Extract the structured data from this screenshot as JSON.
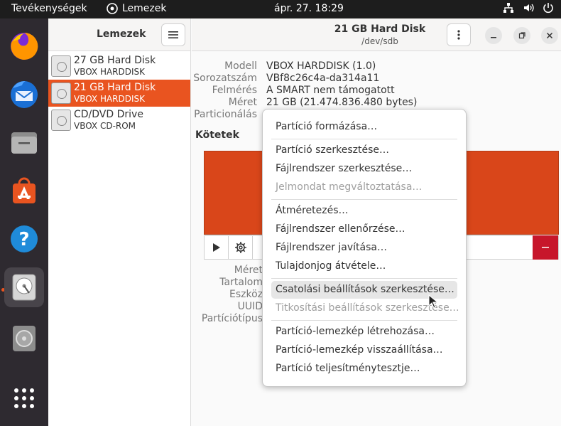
{
  "topbar": {
    "activities": "Tevékenységek",
    "app_name": "Lemezek",
    "clock": "ápr. 27.  18:29"
  },
  "dock": {
    "items": [
      {
        "name": "firefox-icon"
      },
      {
        "name": "thunderbird-icon"
      },
      {
        "name": "files-icon"
      },
      {
        "name": "app-center-icon"
      },
      {
        "name": "help-icon"
      },
      {
        "name": "disks-icon",
        "active": true
      },
      {
        "name": "disc-icon"
      },
      {
        "name": "app-grid-icon"
      }
    ]
  },
  "left": {
    "title": "Lemezek",
    "drives": [
      {
        "name": "27 GB Hard Disk",
        "model": "VBOX HARDDISK",
        "selected": false
      },
      {
        "name": "21 GB Hard Disk",
        "model": "VBOX HARDDISK",
        "selected": true
      },
      {
        "name": "CD/DVD Drive",
        "model": "VBOX CD-ROM",
        "selected": false
      }
    ]
  },
  "right": {
    "title": "21 GB Hard Disk",
    "subtitle": "/dev/sdb",
    "props": [
      {
        "label": "Modell",
        "value": "VBOX HARDDISK (1.0)"
      },
      {
        "label": "Sorozatszám",
        "value": "VBf8c26c4a-da314a11"
      },
      {
        "label": "Felmérés",
        "value": "A SMART nem támogatott"
      },
      {
        "label": "Méret",
        "value": "21 GB (21.474.836.480 bytes)"
      },
      {
        "label": "Particionálás",
        "value": ""
      }
    ],
    "volumes_title": "Kötetek",
    "volume_props": [
      "Méret",
      "Tartalom",
      "Eszköz",
      "UUID",
      "Partíciótípus"
    ],
    "colors": {
      "partition": "#d9461a",
      "delete": "#c7162b",
      "accent": "#e95420"
    }
  },
  "menu": {
    "items": [
      {
        "label": "Partíció formázása…",
        "disabled": false
      },
      {
        "sep": true
      },
      {
        "label": "Partíció szerkesztése…",
        "disabled": false
      },
      {
        "label": "Fájlrendszer szerkesztése…",
        "disabled": false
      },
      {
        "label": "Jelmondat megváltoztatása…",
        "disabled": true
      },
      {
        "sep": true
      },
      {
        "label": "Átméretezés…",
        "disabled": false
      },
      {
        "label": "Fájlrendszer ellenőrzése…",
        "disabled": false
      },
      {
        "label": "Fájlrendszer javítása…",
        "disabled": false
      },
      {
        "label": "Tulajdonjog átvétele…",
        "disabled": false
      },
      {
        "sep": true
      },
      {
        "label": "Csatolási beállítások szerkesztése…",
        "disabled": false,
        "hover": true
      },
      {
        "label": "Titkosítási beállítások szerkesztése…",
        "disabled": true
      },
      {
        "sep": true
      },
      {
        "label": "Partíció-lemezkép létrehozása…",
        "disabled": false
      },
      {
        "label": "Partíció-lemezkép visszaállítása…",
        "disabled": false
      },
      {
        "label": "Partíció teljesítménytesztje…",
        "disabled": false
      }
    ]
  }
}
